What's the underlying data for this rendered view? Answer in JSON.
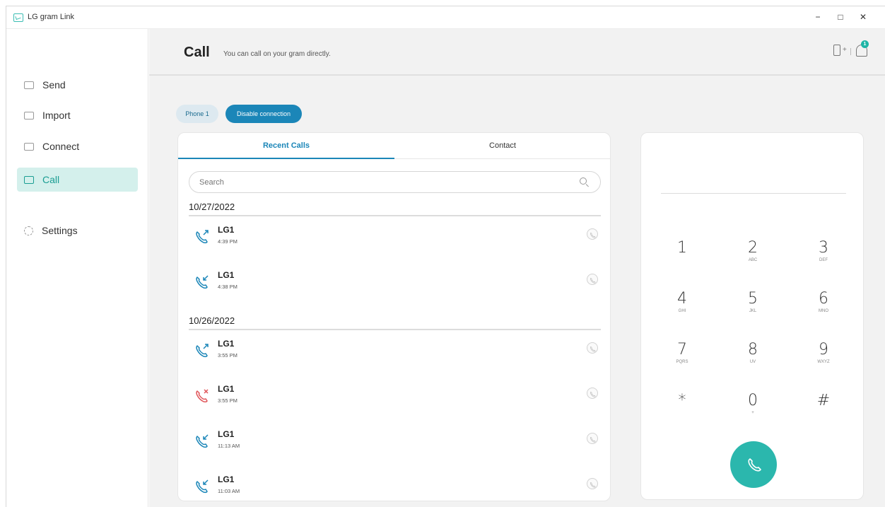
{
  "window": {
    "title": "LG gram Link",
    "minimize": "−",
    "maximize": "□",
    "close": "✕"
  },
  "sidebar": {
    "items": [
      {
        "label": "Send",
        "icon": "send-icon"
      },
      {
        "label": "Import",
        "icon": "import-icon"
      },
      {
        "label": "Connect",
        "icon": "connect-icon"
      },
      {
        "label": "Call",
        "icon": "call-icon",
        "active": true
      },
      {
        "label": "Settings",
        "icon": "gear-icon"
      }
    ]
  },
  "header": {
    "title": "Call",
    "subtitle": "You can call on your gram directly.",
    "add_device_plus": "+",
    "notification_count": "1"
  },
  "connection": {
    "phone_label": "Phone 1",
    "disable_label": "Disable connection"
  },
  "tabs": {
    "recent": "Recent Calls",
    "contact": "Contact"
  },
  "search": {
    "placeholder": "Search"
  },
  "call_groups": [
    {
      "date": "10/27/2022",
      "calls": [
        {
          "name": "LG1",
          "time": "4:39 PM",
          "type": "outgoing"
        },
        {
          "name": "LG1",
          "time": "4:38 PM",
          "type": "incoming"
        }
      ]
    },
    {
      "date": "10/26/2022",
      "calls": [
        {
          "name": "LG1",
          "time": "3:55 PM",
          "type": "outgoing"
        },
        {
          "name": "LG1",
          "time": "3:55 PM",
          "type": "missed"
        },
        {
          "name": "LG1",
          "time": "11:13 AM",
          "type": "incoming"
        },
        {
          "name": "LG1",
          "time": "11:03 AM",
          "type": "incoming"
        }
      ]
    }
  ],
  "dialpad": {
    "keys": [
      {
        "digit": "1",
        "letters": ""
      },
      {
        "digit": "2",
        "letters": "ABC"
      },
      {
        "digit": "3",
        "letters": "DEF"
      },
      {
        "digit": "4",
        "letters": "GHI"
      },
      {
        "digit": "5",
        "letters": "JKL"
      },
      {
        "digit": "6",
        "letters": "MNO"
      },
      {
        "digit": "7",
        "letters": "PQRS"
      },
      {
        "digit": "8",
        "letters": "UV"
      },
      {
        "digit": "9",
        "letters": "WXYZ"
      },
      {
        "digit": "*",
        "letters": ""
      },
      {
        "digit": "0",
        "letters": "+"
      },
      {
        "digit": "#",
        "letters": ""
      }
    ]
  },
  "colors": {
    "accent": "#1b86b8",
    "teal": "#2bb7ad",
    "missed": "#e0565a",
    "active_nav_bg": "#d4f0ec"
  }
}
